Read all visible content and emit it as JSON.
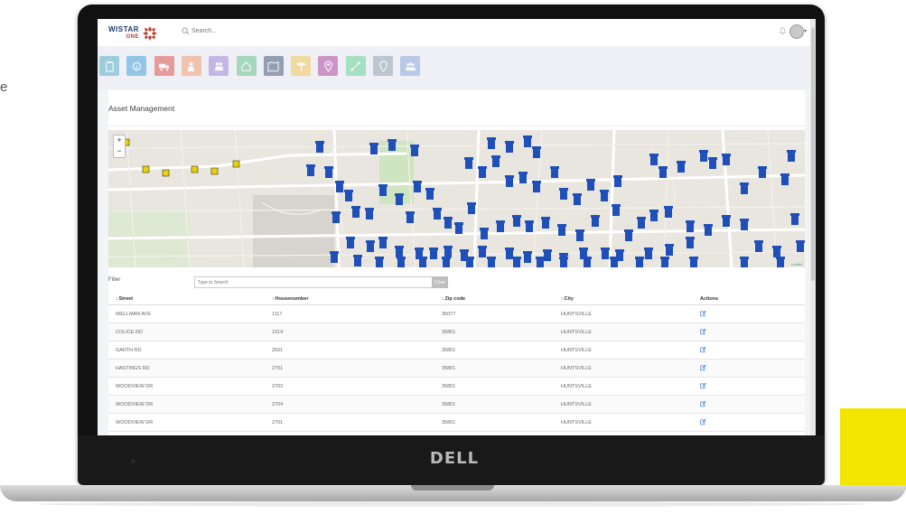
{
  "side_text": "e",
  "device": {
    "brand": "DELL"
  },
  "app": {
    "brand_name": "WISTAR",
    "brand_sub": "ONE",
    "search_placeholder": "Search..."
  },
  "module_icons": [
    {
      "name": "clipboard-icon",
      "color": "#5bb0c9"
    },
    {
      "name": "coins-icon",
      "color": "#4aa3d8"
    },
    {
      "name": "truck-icon",
      "color": "#e0564f"
    },
    {
      "name": "worker-icon",
      "color": "#f0a071"
    },
    {
      "name": "people-icon",
      "color": "#a58ad9"
    },
    {
      "name": "house-icon",
      "color": "#6cc48b"
    },
    {
      "name": "map-icon",
      "color": "#4b5c7e"
    },
    {
      "name": "signpost-icon",
      "color": "#f3c95d"
    },
    {
      "name": "person-pin-icon",
      "color": "#b04ca3"
    },
    {
      "name": "route-icon",
      "color": "#6cd39b"
    },
    {
      "name": "location-icon",
      "color": "#93a5b4"
    },
    {
      "name": "group-icon",
      "color": "#8ea9db"
    }
  ],
  "page": {
    "title": "Asset Management"
  },
  "map": {
    "zoom_in": "+",
    "zoom_out": "−",
    "attribution": "Leaflet",
    "marker_color": "#1f4fb8"
  },
  "filter": {
    "label": "Filter",
    "placeholder": "Type to Search",
    "clear_label": "Clear"
  },
  "table": {
    "columns": {
      "street": "Street",
      "housenumber": "Housenumber",
      "zip": "Zip code",
      "city": "City",
      "actions": "Actions"
    },
    "rows": [
      {
        "street": "WELLMAN AVE",
        "housenumber": "1117",
        "zip": "35077",
        "city": "HUNTSVILLE"
      },
      {
        "street": "COLICE RD",
        "housenumber": "1914",
        "zip": "35801",
        "city": "HUNTSVILLE"
      },
      {
        "street": "GARTH RD",
        "housenumber": "2501",
        "zip": "35801",
        "city": "HUNTSVILLE"
      },
      {
        "street": "HASTINGS RD",
        "housenumber": "2701",
        "zip": "35801",
        "city": "HUNTSVILLE"
      },
      {
        "street": "WOODVIEW DR",
        "housenumber": "2703",
        "zip": "35801",
        "city": "HUNTSVILLE"
      },
      {
        "street": "WOODVIEW DR",
        "housenumber": "2704",
        "zip": "35801",
        "city": "HUNTSVILLE"
      },
      {
        "street": "WOODVIEW DR",
        "housenumber": "2701",
        "zip": "35801",
        "city": "HUNTSVILLE"
      }
    ]
  }
}
